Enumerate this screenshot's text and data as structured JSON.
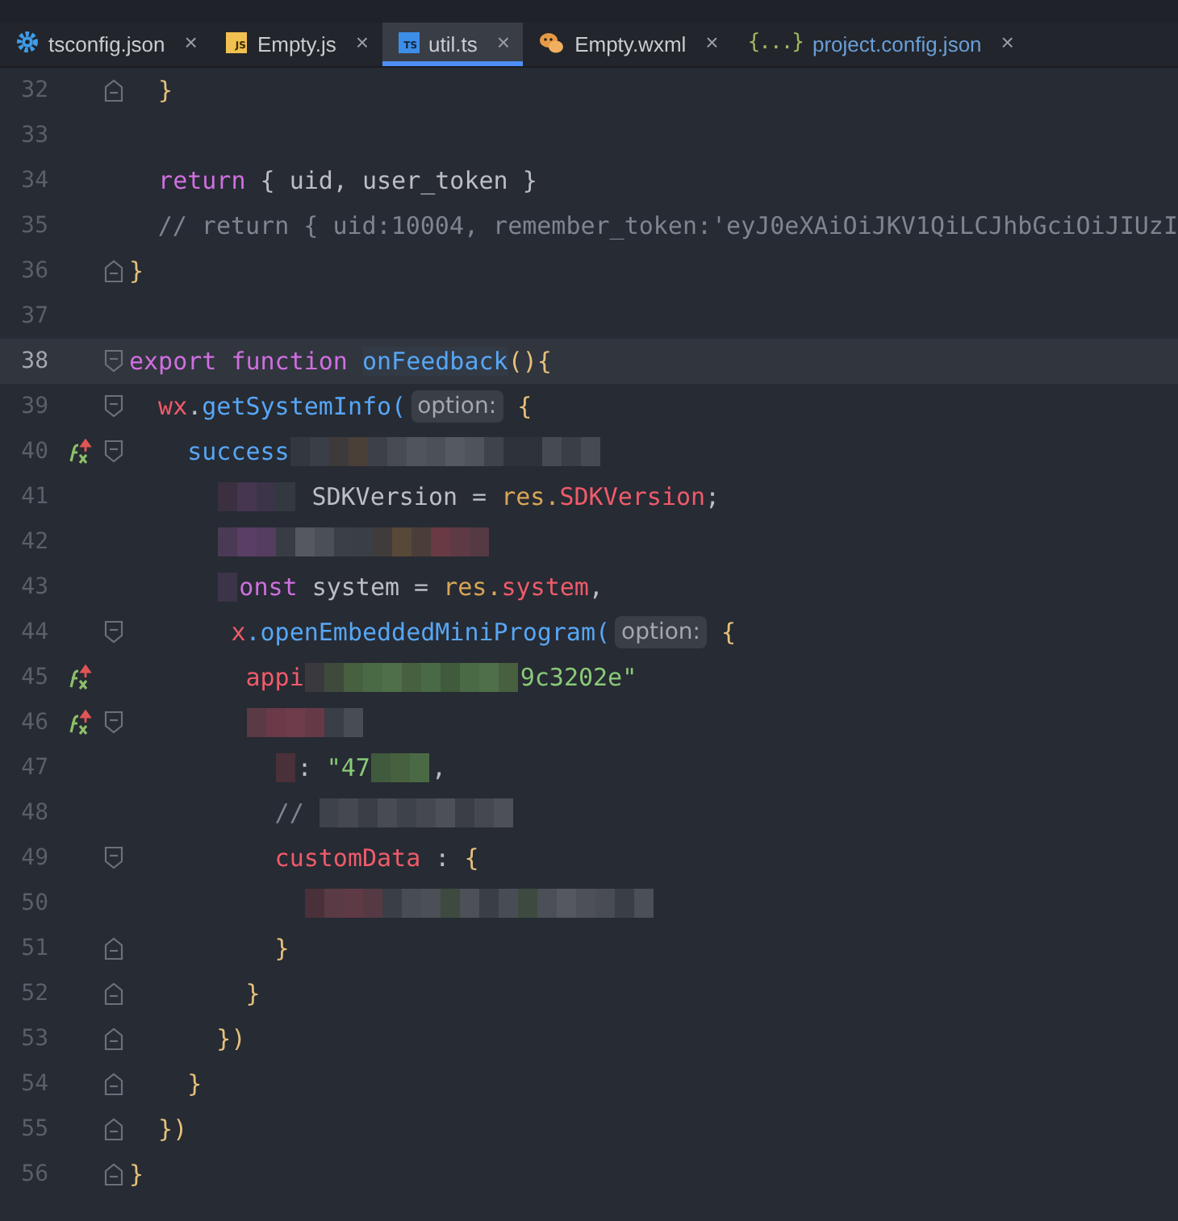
{
  "tabs": [
    {
      "label": "tsconfig.json",
      "kind": "gear",
      "selected": false,
      "modified": false,
      "close": "×"
    },
    {
      "label": "Empty.js",
      "kind": "js",
      "badge": "JS",
      "selected": false,
      "modified": false,
      "close": "×"
    },
    {
      "label": "util.ts",
      "kind": "ts",
      "badge": "TS",
      "selected": true,
      "modified": false,
      "close": "×"
    },
    {
      "label": "Empty.wxml",
      "kind": "chat",
      "selected": false,
      "modified": false,
      "close": "×"
    },
    {
      "label": "project.config.json",
      "kind": "json",
      "badge": "{...}",
      "selected": false,
      "modified": true,
      "close": "×"
    }
  ],
  "editor": {
    "lines": [
      {
        "number": "32",
        "kind": "fold_end",
        "current": false,
        "method_marker": false,
        "tokens": [
          {
            "kind": "brace",
            "t": "  }"
          }
        ]
      },
      {
        "number": "33",
        "kind": "plain",
        "current": false,
        "method_marker": false
      },
      {
        "number": "34",
        "kind": "plain",
        "current": false,
        "method_marker": false,
        "tokens": [
          {
            "kind": "keyword",
            "t": "  return"
          },
          {
            "kind": "text",
            "t": " { uid, user_token }"
          }
        ]
      },
      {
        "number": "35",
        "kind": "plain",
        "current": false,
        "method_marker": false,
        "tokens": [
          {
            "kind": "comment",
            "t": "  // return { uid:10004, remember_token:'eyJ0eXAiOiJKV1QiLCJhbGciOiJIUzI"
          }
        ]
      },
      {
        "number": "36",
        "kind": "fold_end",
        "current": false,
        "method_marker": false,
        "tokens": [
          {
            "kind": "brace",
            "t": "}"
          }
        ]
      },
      {
        "number": "37",
        "kind": "plain",
        "current": false,
        "method_marker": false
      },
      {
        "number": "38",
        "kind": "fold_start",
        "current": true,
        "method_marker": false,
        "tokens": [
          {
            "kind": "keyword",
            "t": "export function "
          },
          {
            "kind": "declaration",
            "t": "onFeedback"
          },
          {
            "kind": "brace",
            "t": "(){"
          }
        ]
      },
      {
        "number": "39",
        "kind": "fold_start",
        "current": false,
        "method_marker": false,
        "tokens": [
          {
            "kind": "var",
            "t": "  wx"
          },
          {
            "kind": "text",
            "t": "."
          },
          {
            "kind": "fn",
            "t": "getSystemInfo("
          },
          {
            "kind": "hint",
            "t": "option:"
          },
          {
            "kind": "brace",
            "t": " {"
          }
        ]
      },
      {
        "number": "40",
        "kind": "fold_start",
        "current": false,
        "method_marker": true,
        "tokens": [
          {
            "kind": "fn",
            "t": "    success"
          },
          {
            "kind": "mosaic",
            "cells": [
              {
                "color": "#33373f"
              },
              {
                "color": "#3a3e46"
              },
              {
                "color": "#3c3a3a"
              },
              {
                "color": "#4a4038"
              },
              {
                "color": "#3d4048"
              },
              {
                "color": "#474b53"
              },
              {
                "color": "#50545c"
              },
              {
                "color": "#4c5058"
              },
              {
                "color": "#555960"
              },
              {
                "color": "#4f535b"
              },
              {
                "color": "#3f434b"
              },
              {
                "color": "#2e3239"
              },
              {
                "color": "#2e3239"
              },
              {
                "color": "#464a52"
              },
              {
                "color": "#3a3e46"
              },
              {
                "color": "#464a52"
              }
            ]
          }
        ]
      },
      {
        "number": "41",
        "kind": "plain",
        "current": false,
        "method_marker": false,
        "tokens": [
          {
            "kind": "mosaic",
            "cells": [
              {
                "color": "#3a3040"
              },
              {
                "color": "#463650"
              },
              {
                "color": "#3c3448"
              },
              {
                "color": "#343840"
              }
            ]
          },
          {
            "kind": "text",
            "t": " SDKVersion = "
          },
          {
            "kind": "param",
            "t": "res."
          },
          {
            "kind": "var",
            "t": "SDKVersion"
          },
          {
            "kind": "text",
            "t": ";"
          }
        ]
      },
      {
        "number": "42",
        "kind": "plain",
        "current": false,
        "method_marker": false,
        "tokens": [
          {
            "kind": "mosaic",
            "cells": [
              {
                "color": "#4a3a55"
              },
              {
                "color": "#5a3e66"
              },
              {
                "color": "#553d60"
              },
              {
                "color": "#383c44"
              },
              {
                "color": "#55585e"
              },
              {
                "color": "#4b4f56"
              },
              {
                "color": "#3b3f47"
              },
              {
                "color": "#3a3e45"
              },
              {
                "color": "#403c3c"
              },
              {
                "color": "#574838"
              },
              {
                "color": "#4a3e3a"
              },
              {
                "color": "#6a3a44"
              },
              {
                "color": "#5e3a44"
              },
              {
                "color": "#553a44"
              }
            ]
          }
        ]
      },
      {
        "number": "43",
        "kind": "plain",
        "current": false,
        "method_marker": false,
        "tokens": [
          {
            "kind": "mosaic",
            "cells": [
              {
                "color": "#3c3448"
              }
            ]
          },
          {
            "kind": "keyword",
            "t": "onst"
          },
          {
            "kind": "text",
            "t": " system = "
          },
          {
            "kind": "param",
            "t": "res."
          },
          {
            "kind": "var",
            "t": "system"
          },
          {
            "kind": "text",
            "t": ","
          }
        ]
      },
      {
        "number": "44",
        "kind": "fold_start",
        "current": false,
        "method_marker": false,
        "tokens": [
          {
            "kind": "var",
            "t": "       x"
          },
          {
            "kind": "fn",
            "t": ".openEmbeddedMiniProgram("
          },
          {
            "kind": "hint",
            "t": "option:"
          },
          {
            "kind": "brace",
            "t": " {"
          }
        ]
      },
      {
        "number": "45",
        "kind": "plain",
        "current": false,
        "method_marker": true,
        "tokens": [
          {
            "kind": "var",
            "t": "        appi"
          },
          {
            "kind": "mosaic",
            "cells": [
              {
                "color": "#3a3a3e"
              },
              {
                "color": "#3f4a3c"
              },
              {
                "color": "#466040"
              },
              {
                "color": "#4a6a46"
              },
              {
                "color": "#4f6f48"
              },
              {
                "color": "#466040"
              },
              {
                "color": "#4a6a46"
              },
              {
                "color": "#3f5a3c"
              },
              {
                "color": "#4a6a46"
              },
              {
                "color": "#4f6f48"
              },
              {
                "color": "#466040"
              }
            ]
          },
          {
            "kind": "string",
            "t": "9c3202e\""
          }
        ]
      },
      {
        "number": "46",
        "kind": "fold_start",
        "current": false,
        "method_marker": true,
        "tokens": [
          {
            "kind": "mosaic",
            "cells": [
              {
                "color": "#5a3a44"
              },
              {
                "color": "#6a3a48"
              },
              {
                "color": "#6e3c4a"
              },
              {
                "color": "#653a46"
              },
              {
                "color": "#3a3e46"
              },
              {
                "color": "#484c54"
              }
            ]
          }
        ]
      },
      {
        "number": "47",
        "kind": "plain",
        "current": false,
        "method_marker": false,
        "tokens": [
          {
            "kind": "mosaic",
            "cells": [
              {
                "color": "#4a3038"
              }
            ]
          },
          {
            "kind": "text",
            "t": ": "
          },
          {
            "kind": "string",
            "t": "\"47"
          },
          {
            "kind": "mosaic",
            "cells": [
              {
                "color": "#3f5a3c"
              },
              {
                "color": "#466040"
              },
              {
                "color": "#4a6a46"
              }
            ]
          },
          {
            "kind": "text",
            "t": ","
          }
        ]
      },
      {
        "number": "48",
        "kind": "plain",
        "current": false,
        "method_marker": false,
        "tokens": [
          {
            "kind": "comment",
            "t": "          // "
          },
          {
            "kind": "mosaic",
            "cells": [
              {
                "color": "#3e4249"
              },
              {
                "color": "#45494f"
              },
              {
                "color": "#3a3e45"
              },
              {
                "color": "#484c52"
              },
              {
                "color": "#3e4249"
              },
              {
                "color": "#45494f"
              },
              {
                "color": "#4d5157"
              },
              {
                "color": "#3a3e45"
              },
              {
                "color": "#45494f"
              },
              {
                "color": "#4d5157"
              }
            ]
          }
        ]
      },
      {
        "number": "49",
        "kind": "fold_start",
        "current": false,
        "method_marker": false,
        "tokens": [
          {
            "kind": "var",
            "t": "          customData"
          },
          {
            "kind": "text",
            "t": " : "
          },
          {
            "kind": "brace",
            "t": "{"
          }
        ]
      },
      {
        "number": "50",
        "kind": "plain",
        "current": false,
        "method_marker": false,
        "tokens": [
          {
            "kind": "mosaic",
            "cells": [
              {
                "color": "#4a3038"
              },
              {
                "color": "#5a3a44"
              },
              {
                "color": "#5e3a44"
              },
              {
                "color": "#553a44"
              },
              {
                "color": "#3a3e45"
              },
              {
                "color": "#484c54"
              },
              {
                "color": "#4b4f56"
              },
              {
                "color": "#3e4a40"
              },
              {
                "color": "#4d5157"
              },
              {
                "color": "#3a3e45"
              },
              {
                "color": "#484c54"
              },
              {
                "color": "#3e4a40"
              },
              {
                "color": "#4b4f56"
              },
              {
                "color": "#55585e"
              },
              {
                "color": "#4d5157"
              },
              {
                "color": "#484c54"
              },
              {
                "color": "#3a3e45"
              },
              {
                "color": "#4b4f56"
              }
            ]
          }
        ]
      },
      {
        "number": "51",
        "kind": "fold_end",
        "current": false,
        "method_marker": false,
        "tokens": [
          {
            "kind": "brace",
            "t": "          }"
          }
        ]
      },
      {
        "number": "52",
        "kind": "fold_end",
        "current": false,
        "method_marker": false,
        "tokens": [
          {
            "kind": "brace",
            "t": "        }"
          }
        ]
      },
      {
        "number": "53",
        "kind": "fold_end",
        "current": false,
        "method_marker": false,
        "tokens": [
          {
            "kind": "brace",
            "t": "      })"
          }
        ]
      },
      {
        "number": "54",
        "kind": "fold_end",
        "current": false,
        "method_marker": false,
        "tokens": [
          {
            "kind": "brace",
            "t": "    }"
          }
        ]
      },
      {
        "number": "55",
        "kind": "fold_end",
        "current": false,
        "method_marker": false,
        "tokens": [
          {
            "kind": "brace",
            "t": "  })"
          }
        ]
      },
      {
        "number": "56",
        "kind": "fold_end",
        "current": false,
        "method_marker": false,
        "tokens": [
          {
            "kind": "brace",
            "t": "}"
          }
        ]
      }
    ]
  }
}
